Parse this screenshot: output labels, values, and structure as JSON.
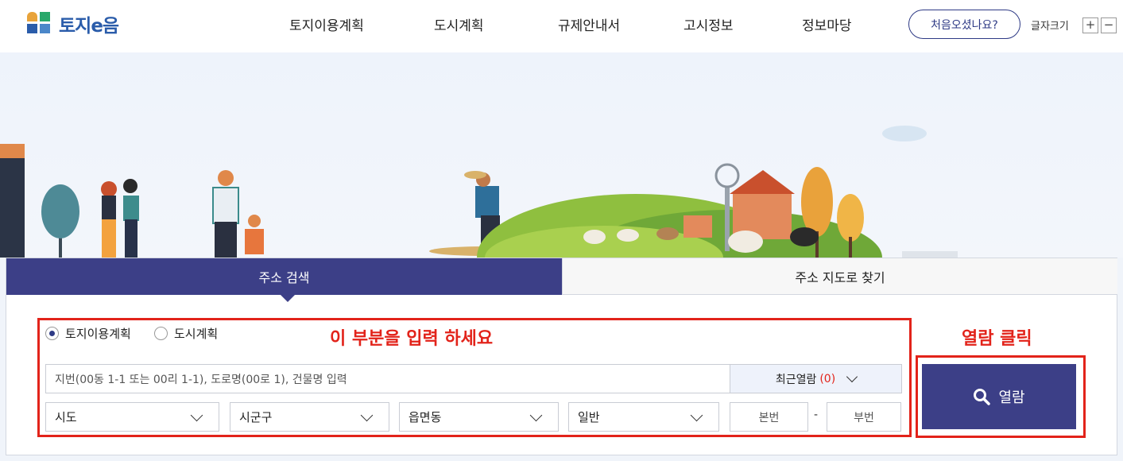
{
  "header": {
    "logo_text": "토지e음",
    "nav": [
      "토지이용계획",
      "도시계획",
      "규제안내서",
      "고시정보",
      "정보마당"
    ],
    "first_visit": "처음오셨나요?",
    "font_size_label": "글자크기",
    "font_plus": "+",
    "font_minus": "−"
  },
  "tabs": {
    "active": "주소 검색",
    "inactive": "주소 지도로 찾기"
  },
  "search": {
    "radio_land": "토지이용계획",
    "radio_city": "도시계획",
    "address_placeholder": "지번(00동 1-1 또는 00리 1-1), 도로명(00로 1), 건물명 입력",
    "recent_label": "최근열람",
    "recent_count": "(0)",
    "sido": "시도",
    "sigungu": "시군구",
    "eupmyeondong": "읍면동",
    "land_type": "일반",
    "main_no": "본번",
    "dash": "-",
    "sub_no": "부번",
    "view_button": "열람"
  },
  "annotations": {
    "input_hint": "이 부분을 입력 하세요",
    "click_hint": "열람 클릭"
  },
  "colors": {
    "primary": "#3c3f87",
    "annotation": "#e2231a"
  }
}
